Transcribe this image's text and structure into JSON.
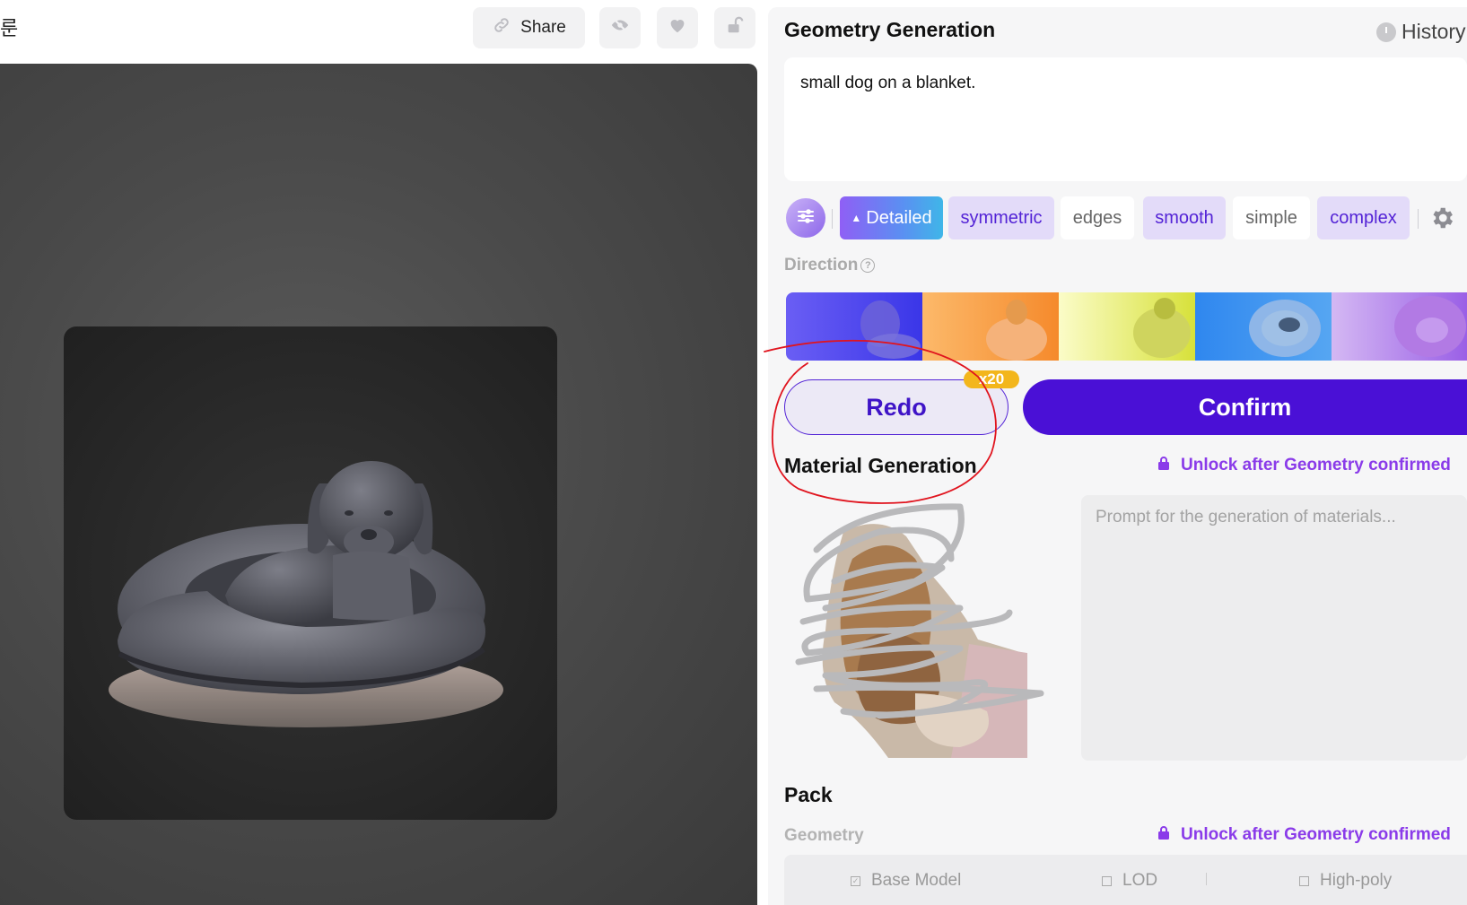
{
  "topbar": {
    "corner_glyph": "룬",
    "share_label": "Share",
    "icons": [
      "link-icon",
      "eye-off-icon",
      "heart-icon",
      "unlock-icon"
    ]
  },
  "geometry": {
    "title": "Geometry Generation",
    "history_label": "History",
    "prompt_text": "small dog on a blanket.",
    "tags": [
      {
        "label": "Detailed",
        "state": "primary"
      },
      {
        "label": "symmetric",
        "state": "on"
      },
      {
        "label": "edges",
        "state": "off"
      },
      {
        "label": "smooth",
        "state": "on"
      },
      {
        "label": "simple",
        "state": "off"
      },
      {
        "label": "complex",
        "state": "on"
      }
    ],
    "direction_label": "Direction",
    "direction_help": "?",
    "direction_thumbs": [
      {
        "tint": "#5a4cf0"
      },
      {
        "tint": "#f7a04a"
      },
      {
        "tint": "#e7ec4a"
      },
      {
        "tint": "#3d90ee"
      },
      {
        "tint": "#b07ee8"
      }
    ],
    "redo_label": "Redo",
    "redo_cost": "x20",
    "confirm_label": "Confirm"
  },
  "material": {
    "title": "Material Generation",
    "lock_note": "Unlock after Geometry confirmed",
    "prompt_placeholder": "Prompt for the generation of materials..."
  },
  "pack": {
    "title": "Pack",
    "geometry_label": "Geometry",
    "lock_note": "Unlock after Geometry confirmed",
    "options": [
      {
        "label": "Base Model",
        "checked": true
      },
      {
        "label": "LOD",
        "checked": false
      },
      {
        "label": "High-poly",
        "checked": false
      }
    ]
  },
  "colors": {
    "accent": "#4a10d6",
    "accent_light": "#e3dbf9",
    "lock_note": "#8a3be9",
    "badge": "#f3b61c",
    "annotation_red": "#e0141e"
  }
}
